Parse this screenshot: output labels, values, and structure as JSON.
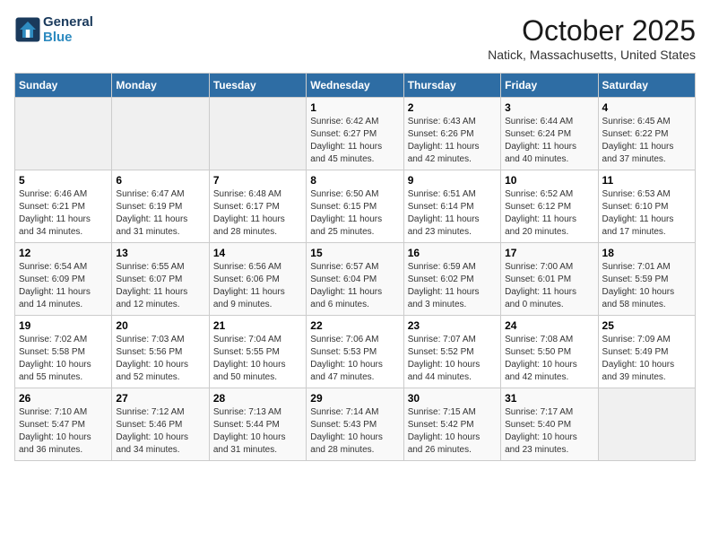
{
  "header": {
    "logo_line1": "General",
    "logo_line2": "Blue",
    "month_year": "October 2025",
    "location": "Natick, Massachusetts, United States"
  },
  "weekdays": [
    "Sunday",
    "Monday",
    "Tuesday",
    "Wednesday",
    "Thursday",
    "Friday",
    "Saturday"
  ],
  "weeks": [
    [
      {
        "num": "",
        "info": ""
      },
      {
        "num": "",
        "info": ""
      },
      {
        "num": "",
        "info": ""
      },
      {
        "num": "1",
        "info": "Sunrise: 6:42 AM\nSunset: 6:27 PM\nDaylight: 11 hours\nand 45 minutes."
      },
      {
        "num": "2",
        "info": "Sunrise: 6:43 AM\nSunset: 6:26 PM\nDaylight: 11 hours\nand 42 minutes."
      },
      {
        "num": "3",
        "info": "Sunrise: 6:44 AM\nSunset: 6:24 PM\nDaylight: 11 hours\nand 40 minutes."
      },
      {
        "num": "4",
        "info": "Sunrise: 6:45 AM\nSunset: 6:22 PM\nDaylight: 11 hours\nand 37 minutes."
      }
    ],
    [
      {
        "num": "5",
        "info": "Sunrise: 6:46 AM\nSunset: 6:21 PM\nDaylight: 11 hours\nand 34 minutes."
      },
      {
        "num": "6",
        "info": "Sunrise: 6:47 AM\nSunset: 6:19 PM\nDaylight: 11 hours\nand 31 minutes."
      },
      {
        "num": "7",
        "info": "Sunrise: 6:48 AM\nSunset: 6:17 PM\nDaylight: 11 hours\nand 28 minutes."
      },
      {
        "num": "8",
        "info": "Sunrise: 6:50 AM\nSunset: 6:15 PM\nDaylight: 11 hours\nand 25 minutes."
      },
      {
        "num": "9",
        "info": "Sunrise: 6:51 AM\nSunset: 6:14 PM\nDaylight: 11 hours\nand 23 minutes."
      },
      {
        "num": "10",
        "info": "Sunrise: 6:52 AM\nSunset: 6:12 PM\nDaylight: 11 hours\nand 20 minutes."
      },
      {
        "num": "11",
        "info": "Sunrise: 6:53 AM\nSunset: 6:10 PM\nDaylight: 11 hours\nand 17 minutes."
      }
    ],
    [
      {
        "num": "12",
        "info": "Sunrise: 6:54 AM\nSunset: 6:09 PM\nDaylight: 11 hours\nand 14 minutes."
      },
      {
        "num": "13",
        "info": "Sunrise: 6:55 AM\nSunset: 6:07 PM\nDaylight: 11 hours\nand 12 minutes."
      },
      {
        "num": "14",
        "info": "Sunrise: 6:56 AM\nSunset: 6:06 PM\nDaylight: 11 hours\nand 9 minutes."
      },
      {
        "num": "15",
        "info": "Sunrise: 6:57 AM\nSunset: 6:04 PM\nDaylight: 11 hours\nand 6 minutes."
      },
      {
        "num": "16",
        "info": "Sunrise: 6:59 AM\nSunset: 6:02 PM\nDaylight: 11 hours\nand 3 minutes."
      },
      {
        "num": "17",
        "info": "Sunrise: 7:00 AM\nSunset: 6:01 PM\nDaylight: 11 hours\nand 0 minutes."
      },
      {
        "num": "18",
        "info": "Sunrise: 7:01 AM\nSunset: 5:59 PM\nDaylight: 10 hours\nand 58 minutes."
      }
    ],
    [
      {
        "num": "19",
        "info": "Sunrise: 7:02 AM\nSunset: 5:58 PM\nDaylight: 10 hours\nand 55 minutes."
      },
      {
        "num": "20",
        "info": "Sunrise: 7:03 AM\nSunset: 5:56 PM\nDaylight: 10 hours\nand 52 minutes."
      },
      {
        "num": "21",
        "info": "Sunrise: 7:04 AM\nSunset: 5:55 PM\nDaylight: 10 hours\nand 50 minutes."
      },
      {
        "num": "22",
        "info": "Sunrise: 7:06 AM\nSunset: 5:53 PM\nDaylight: 10 hours\nand 47 minutes."
      },
      {
        "num": "23",
        "info": "Sunrise: 7:07 AM\nSunset: 5:52 PM\nDaylight: 10 hours\nand 44 minutes."
      },
      {
        "num": "24",
        "info": "Sunrise: 7:08 AM\nSunset: 5:50 PM\nDaylight: 10 hours\nand 42 minutes."
      },
      {
        "num": "25",
        "info": "Sunrise: 7:09 AM\nSunset: 5:49 PM\nDaylight: 10 hours\nand 39 minutes."
      }
    ],
    [
      {
        "num": "26",
        "info": "Sunrise: 7:10 AM\nSunset: 5:47 PM\nDaylight: 10 hours\nand 36 minutes."
      },
      {
        "num": "27",
        "info": "Sunrise: 7:12 AM\nSunset: 5:46 PM\nDaylight: 10 hours\nand 34 minutes."
      },
      {
        "num": "28",
        "info": "Sunrise: 7:13 AM\nSunset: 5:44 PM\nDaylight: 10 hours\nand 31 minutes."
      },
      {
        "num": "29",
        "info": "Sunrise: 7:14 AM\nSunset: 5:43 PM\nDaylight: 10 hours\nand 28 minutes."
      },
      {
        "num": "30",
        "info": "Sunrise: 7:15 AM\nSunset: 5:42 PM\nDaylight: 10 hours\nand 26 minutes."
      },
      {
        "num": "31",
        "info": "Sunrise: 7:17 AM\nSunset: 5:40 PM\nDaylight: 10 hours\nand 23 minutes."
      },
      {
        "num": "",
        "info": ""
      }
    ]
  ]
}
